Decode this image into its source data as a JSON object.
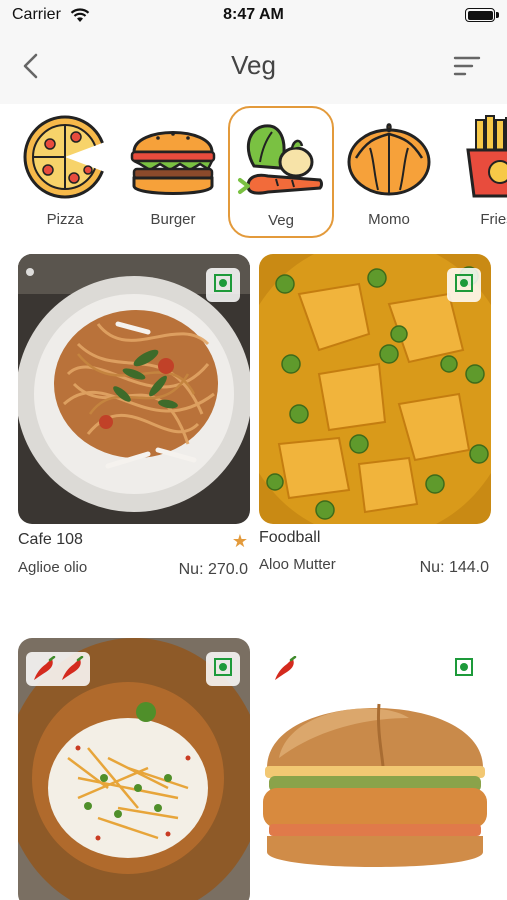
{
  "status_bar": {
    "carrier": "Carrier",
    "time": "8:47 AM"
  },
  "header": {
    "title": "Veg"
  },
  "categories": [
    {
      "label": "Pizza",
      "icon": "pizza-icon"
    },
    {
      "label": "Burger",
      "icon": "burger-icon"
    },
    {
      "label": "Veg",
      "icon": "veg-icon",
      "selected": true
    },
    {
      "label": "Momo",
      "icon": "momo-icon"
    },
    {
      "label": "Fries",
      "icon": "fries-icon"
    }
  ],
  "items": [
    {
      "restaurant": "Cafe 108",
      "dish": "Aglioe olio",
      "price": "Nu: 270.0",
      "featured": true,
      "veg": true,
      "spice_level": 0
    },
    {
      "restaurant": "Foodball",
      "dish": "Aloo Mutter",
      "price": "Nu: 144.0",
      "featured": false,
      "veg": true,
      "spice_level": 0
    },
    {
      "restaurant": "",
      "dish": "",
      "price": "",
      "featured": false,
      "veg": true,
      "spice_level": 2
    },
    {
      "restaurant": "",
      "dish": "",
      "price": "",
      "featured": false,
      "veg": true,
      "spice_level": 1
    }
  ],
  "colors": {
    "accent": "#e39a3b",
    "veg_green": "#1d9a3a",
    "header_bg": "#f7f7f7"
  }
}
